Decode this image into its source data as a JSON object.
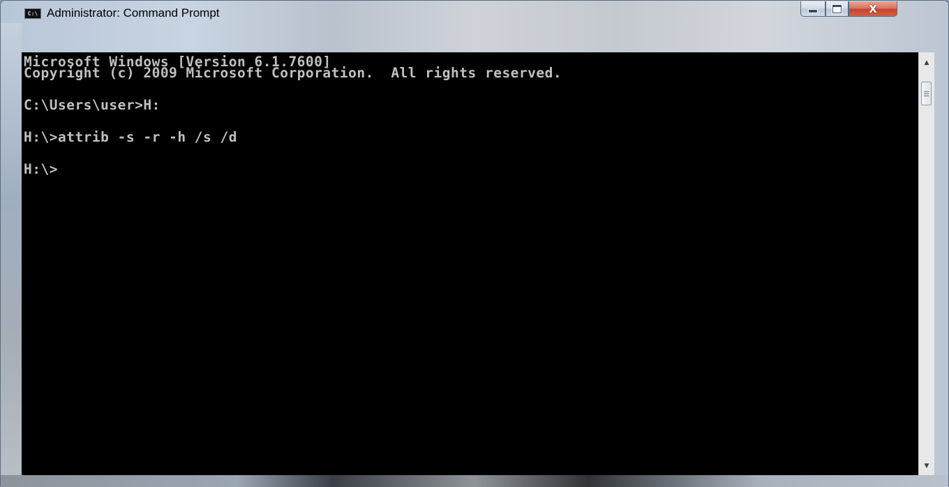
{
  "window": {
    "title": "Administrator: Command Prompt",
    "icon": "cmd-icon",
    "icon_text": "C:\\"
  },
  "caption_buttons": {
    "minimize": "minimize-icon",
    "maximize": "maximize-icon",
    "close": "close-icon",
    "close_glyph": "X"
  },
  "console": {
    "lines": [
      "Microsoft Windows [Version 6.1.7600]",
      "Copyright (c) 2009 Microsoft Corporation.  All rights reserved.",
      "C:\\Users\\user>H:",
      "H:\\>attrib -s -r -h /s /d",
      "H:\\>"
    ],
    "text_color": "#c0c0c0",
    "background_color": "#000000"
  },
  "scrollbar": {
    "up_arrow": "▲",
    "down_arrow": "▼"
  }
}
